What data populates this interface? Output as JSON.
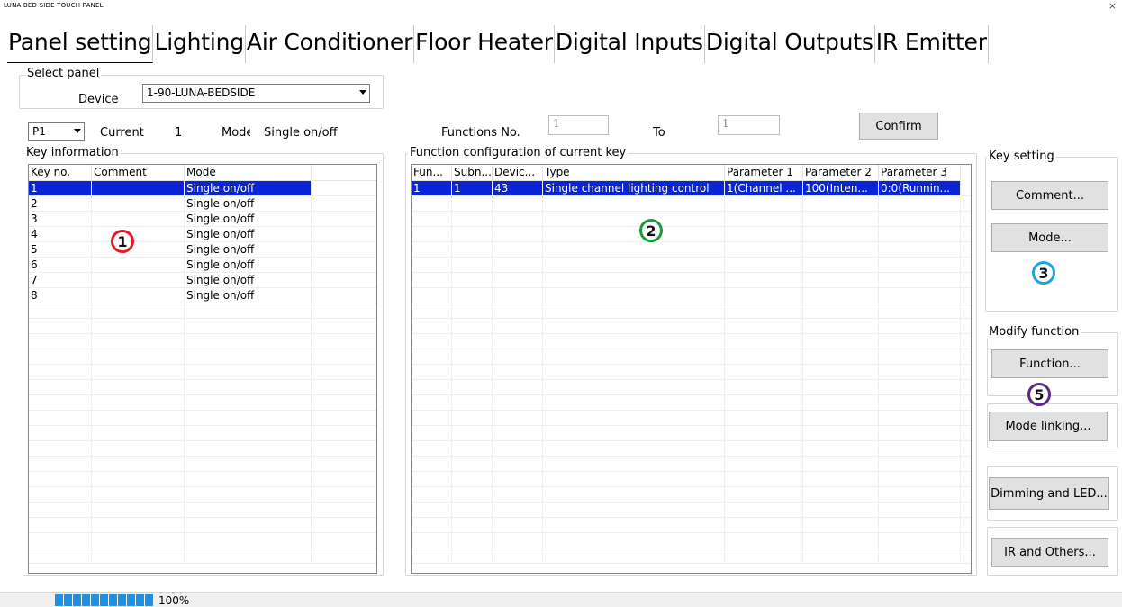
{
  "window": {
    "title": "LUNA BED SIDE TOUCH PANEL",
    "close": "×"
  },
  "tabs": [
    {
      "label": "Panel setting"
    },
    {
      "label": "Lighting"
    },
    {
      "label": "Air Conditioner"
    },
    {
      "label": "Floor Heater"
    },
    {
      "label": "Digital Inputs"
    },
    {
      "label": "Digital Outputs"
    },
    {
      "label": "IR Emitter"
    }
  ],
  "select_panel": {
    "legend": "Select panel",
    "device_label": "Device",
    "device_value": "1-90-LUNA-BEDSIDE"
  },
  "key_bar": {
    "page_value": "P1",
    "current_label": "Current",
    "current_value": "1",
    "mode_label": "Mode",
    "mode_value": "Single on/off"
  },
  "functions": {
    "label": "Functions No.",
    "from_value": "1",
    "to_label": "To",
    "to_value": "1",
    "confirm_label": "Confirm"
  },
  "key_info": {
    "legend": "Key information",
    "columns": [
      "Key no.",
      "Comment",
      "Mode",
      ""
    ],
    "rows": [
      [
        "1",
        "",
        "Single on/off"
      ],
      [
        "2",
        "",
        "Single on/off"
      ],
      [
        "3",
        "",
        "Single on/off"
      ],
      [
        "4",
        "",
        "Single on/off"
      ],
      [
        "5",
        "",
        "Single on/off"
      ],
      [
        "6",
        "",
        "Single on/off"
      ],
      [
        "7",
        "",
        "Single on/off"
      ],
      [
        "8",
        "",
        "Single on/off"
      ]
    ]
  },
  "func_config": {
    "legend": "Function configuration of current key",
    "columns": [
      "Fun...",
      "Subn...",
      "Devic...",
      "Type",
      "Parameter 1",
      "Parameter 2",
      "Parameter 3"
    ],
    "rows": [
      [
        "1",
        "1",
        "43",
        "Single channel lighting control",
        "1(Channel ...",
        "100(Inten...",
        "0:0(Runnin..."
      ]
    ]
  },
  "key_setting": {
    "legend": "Key setting",
    "comment_button": "Comment...",
    "mode_button": "Mode..."
  },
  "modify_function": {
    "legend": "Modify function",
    "function_button": "Function..."
  },
  "other_buttons": {
    "mode_linking": "Mode linking...",
    "dimming_led": "Dimming and LED...",
    "ir_others": "IR and Others..."
  },
  "markers": [
    {
      "label": "1",
      "color": "#e01b24"
    },
    {
      "label": "2",
      "color": "#1a9b3a"
    },
    {
      "label": "3",
      "color": "#1aa7e0"
    },
    {
      "label": "5",
      "color": "#5b2a86"
    }
  ],
  "status": {
    "progress_text": "100%",
    "progress_value": 1.0
  }
}
